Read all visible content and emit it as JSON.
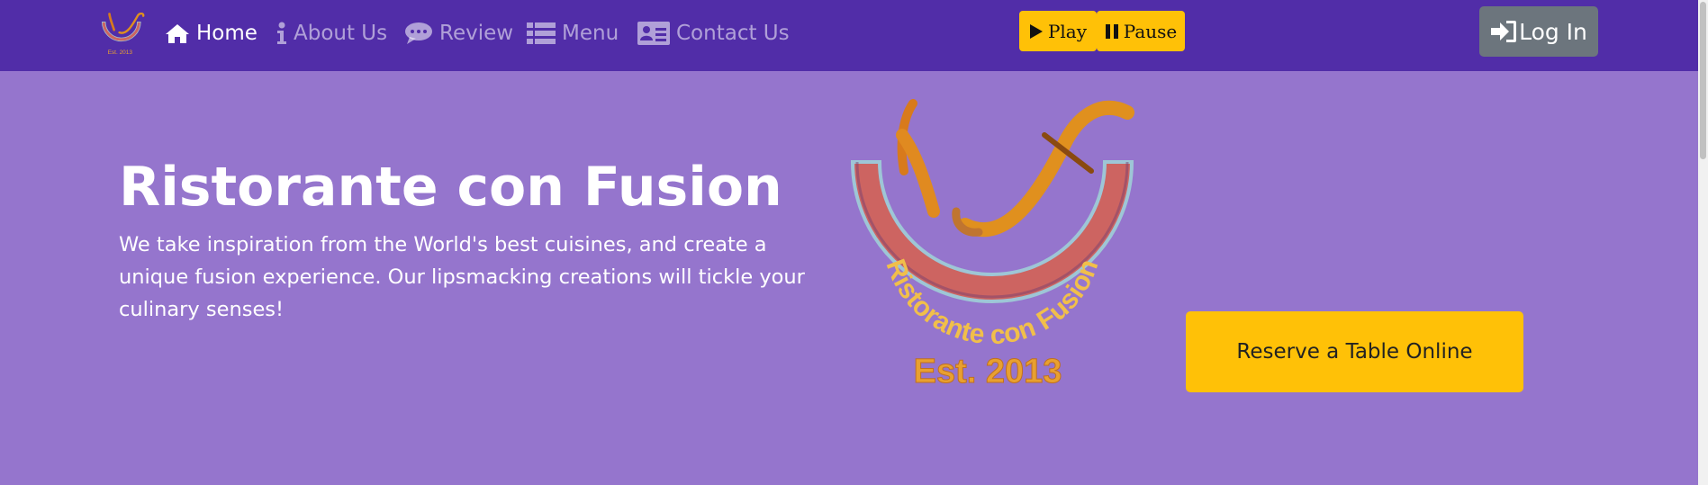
{
  "nav": {
    "items": [
      {
        "label": "Home",
        "icon": "home-icon",
        "active": true
      },
      {
        "label": "About Us",
        "icon": "info-icon",
        "active": false
      },
      {
        "label": "Review",
        "icon": "comment-icon",
        "active": false
      },
      {
        "label": "Menu",
        "icon": "list-icon",
        "active": false
      },
      {
        "label": "Contact Us",
        "icon": "address-card-icon",
        "active": false
      }
    ],
    "play_label": "Play",
    "pause_label": "Pause",
    "login_label": "Log In"
  },
  "logo": {
    "name": "Ristorante con Fusion",
    "est": "Est. 2013"
  },
  "hero": {
    "title": "Ristorante con Fusion",
    "lead": "We take inspiration from the World's best cuisines, and create a unique fusion experience. Our lipsmacking creations will tickle your culinary senses!",
    "reserve_label": "Reserve a Table Online"
  },
  "colors": {
    "navbar": "#512DA8",
    "background": "#9575CD",
    "accent": "#FFC107",
    "login": "#6C757D"
  }
}
